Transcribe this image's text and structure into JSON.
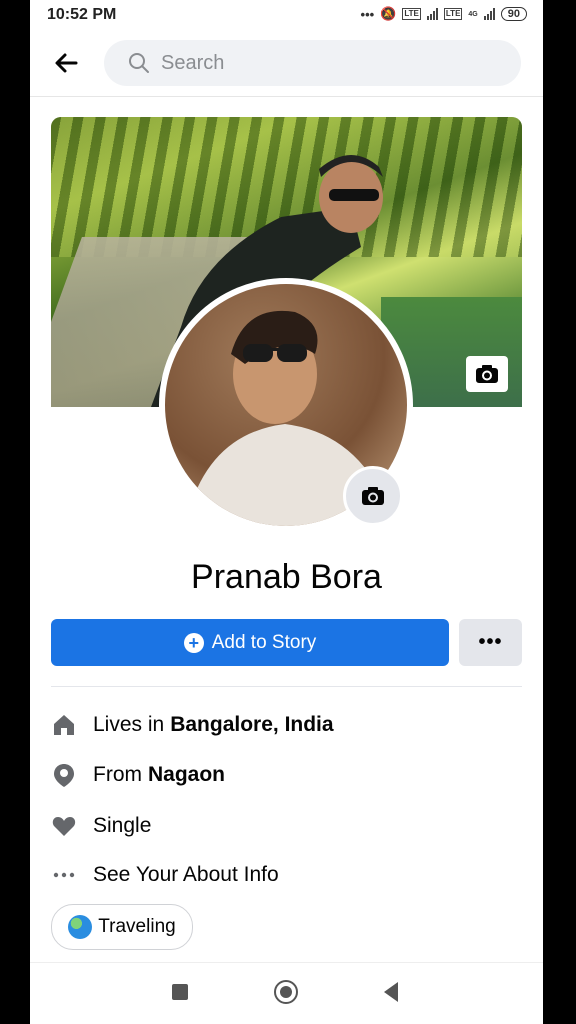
{
  "status_bar": {
    "time": "10:52 PM",
    "battery": "90",
    "network_small": "4G"
  },
  "search": {
    "placeholder": "Search"
  },
  "profile": {
    "name": "Pranab Bora"
  },
  "actions": {
    "add_story": "Add to Story",
    "more": "•••"
  },
  "info": [
    {
      "icon": "home-icon",
      "prefix": "Lives in",
      "bold": "Bangalore, India"
    },
    {
      "icon": "location-pin-icon",
      "prefix": "From",
      "bold": "Nagaon"
    },
    {
      "icon": "heart-icon",
      "prefix": "Single",
      "bold": ""
    },
    {
      "icon": "more-dots-icon",
      "prefix": "See Your About Info",
      "bold": ""
    }
  ],
  "chip": {
    "label": "Traveling"
  },
  "colors": {
    "primary": "#1b74e4",
    "secondary_button": "#e4e6eb",
    "text": "#050505"
  }
}
